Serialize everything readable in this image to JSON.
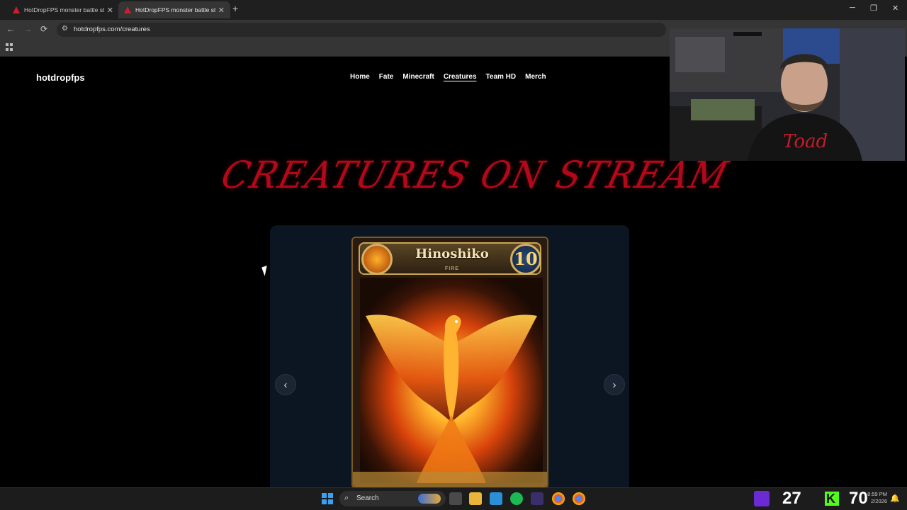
{
  "browser": {
    "tabs": [
      {
        "title": "HotDropFPS monster battle sty",
        "active": false
      },
      {
        "title": "HotDropFPS monster battle sty",
        "active": true
      }
    ],
    "new_tab_label": "+",
    "address": "hotdropfps.com/creatures",
    "window_controls": {
      "minimize": "─",
      "restore": "❐",
      "close": "✕"
    },
    "nav": {
      "back": "←",
      "forward": "→",
      "reload": "⟳"
    }
  },
  "site": {
    "brand": "hotdropfps",
    "nav": [
      "Home",
      "Fate",
      "Minecraft",
      "Creatures",
      "Team HD",
      "Merch"
    ],
    "current_nav": "Creatures",
    "heading": "CREATURES ON STREAM",
    "carousel": {
      "prev_label": "‹",
      "next_label": "›",
      "card": {
        "name": "Hinoshiko",
        "type": "FIRE",
        "level": "10",
        "element_icon": "flame-icon"
      }
    }
  },
  "taskbar": {
    "search_label": "Search",
    "temp_widget": "27",
    "counter": "70",
    "clock_time": "8:59 PM",
    "clock_date": "2/2026"
  },
  "colors": {
    "heading": "#b3081a",
    "background": "#000000",
    "carousel_bg": "#0c1622",
    "kick": "#53fc18",
    "twitch": "#6b2ad3"
  }
}
